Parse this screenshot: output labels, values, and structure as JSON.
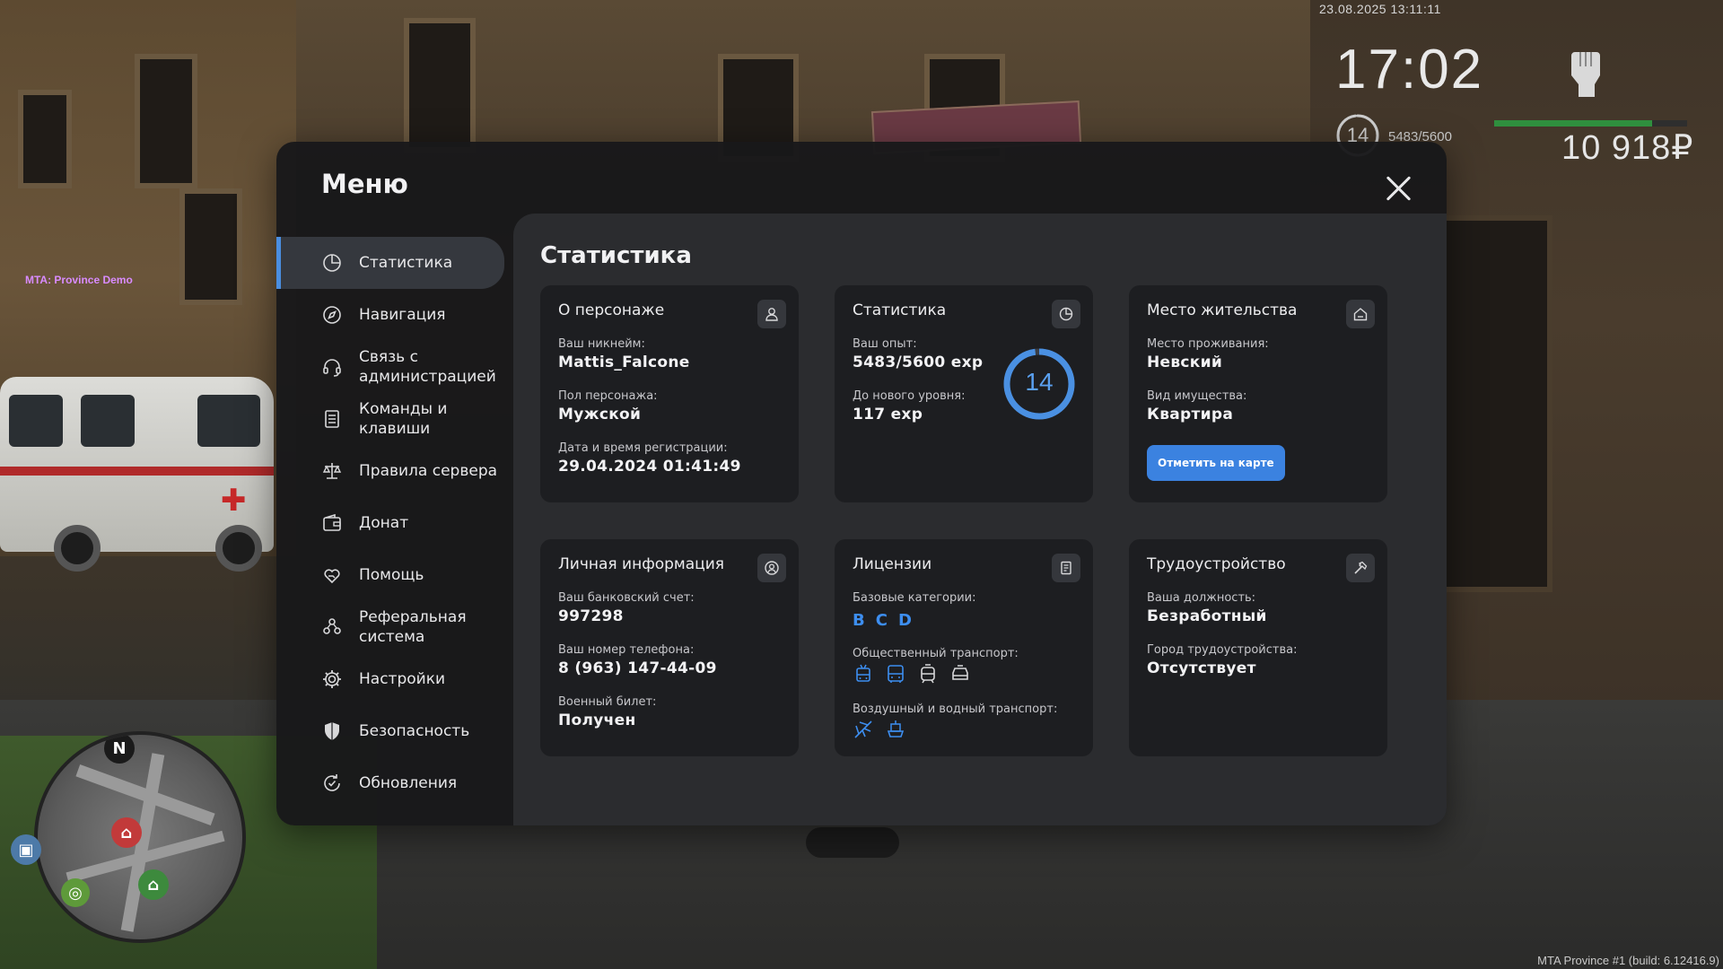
{
  "hud": {
    "datetime": "23.08.2025 13:11:11",
    "clock": "17:02",
    "level": "14",
    "exp": "5483/5600",
    "exp_progress": 0.979,
    "health": 0.82,
    "money": "10 918₽",
    "server_tag": "MTA: Province Demo",
    "build": "MTA Province #1 (build: 6.12416.9)",
    "minimap_north": "N"
  },
  "menu": {
    "title": "Меню",
    "nav": [
      {
        "label": "Статистика",
        "icon": "pie-chart-icon"
      },
      {
        "label": "Навигация",
        "icon": "compass-icon"
      },
      {
        "label": "Связь с администрацией",
        "icon": "headset-icon"
      },
      {
        "label": "Команды и клавиши",
        "icon": "list-icon"
      },
      {
        "label": "Правила сервера",
        "icon": "scales-icon"
      },
      {
        "label": "Донат",
        "icon": "wallet-icon"
      },
      {
        "label": "Помощь",
        "icon": "heart-hand-icon"
      },
      {
        "label": "Реферальная система",
        "icon": "people-icon"
      },
      {
        "label": "Настройки",
        "icon": "gear-icon"
      },
      {
        "label": "Безопасность",
        "icon": "shield-icon"
      },
      {
        "label": "Обновления",
        "icon": "refresh-icon"
      }
    ]
  },
  "content": {
    "title": "Статистика",
    "character": {
      "title": "О персонаже",
      "icon": "user-icon",
      "nick_label": "Ваш никнейм:",
      "nick": "Mattis_Falcone",
      "gender_label": "Пол персонажа:",
      "gender": "Мужской",
      "reg_label": "Дата и время регистрации:",
      "reg": "29.04.2024 01:41:49"
    },
    "stats": {
      "title": "Статистика",
      "icon": "pie-chart-icon",
      "exp_label": "Ваш опыт:",
      "exp": "5483/5600 exp",
      "next_label": "До нового уровня:",
      "next": "117 exp",
      "level": "14",
      "progress": 0.979,
      "accent": "#4a90e2"
    },
    "residence": {
      "title": "Место жительства",
      "icon": "house-icon",
      "place_label": "Место проживания:",
      "place": "Невский",
      "type_label": "Вид имущества:",
      "type": "Квартира",
      "button": "Отметить на карте"
    },
    "personal": {
      "title": "Личная информация",
      "icon": "user-circle-icon",
      "bank_label": "Ваш банковский счет:",
      "bank": "997298",
      "phone_label": "Ваш номер телефона:",
      "phone": "8 (963) 147-44-09",
      "military_label": "Военный билет:",
      "military": "Получен"
    },
    "licenses": {
      "title": "Лицензии",
      "icon": "document-icon",
      "base_label": "Базовые категории:",
      "base": [
        "B",
        "C",
        "D"
      ],
      "public_label": "Общественный транспорт:",
      "public_icons": [
        "trolleybus-icon",
        "bus-icon",
        "tram-icon",
        "taxi-icon"
      ],
      "air_label": "Воздушный и водный транспорт:",
      "air_icons": [
        "plane-icon",
        "boat-icon"
      ]
    },
    "job": {
      "title": "Трудоустройство",
      "icon": "hammer-icon",
      "position_label": "Ваша должность:",
      "position": "Безработный",
      "city_label": "Город трудоустройства:",
      "city": "Отсутствует"
    }
  }
}
